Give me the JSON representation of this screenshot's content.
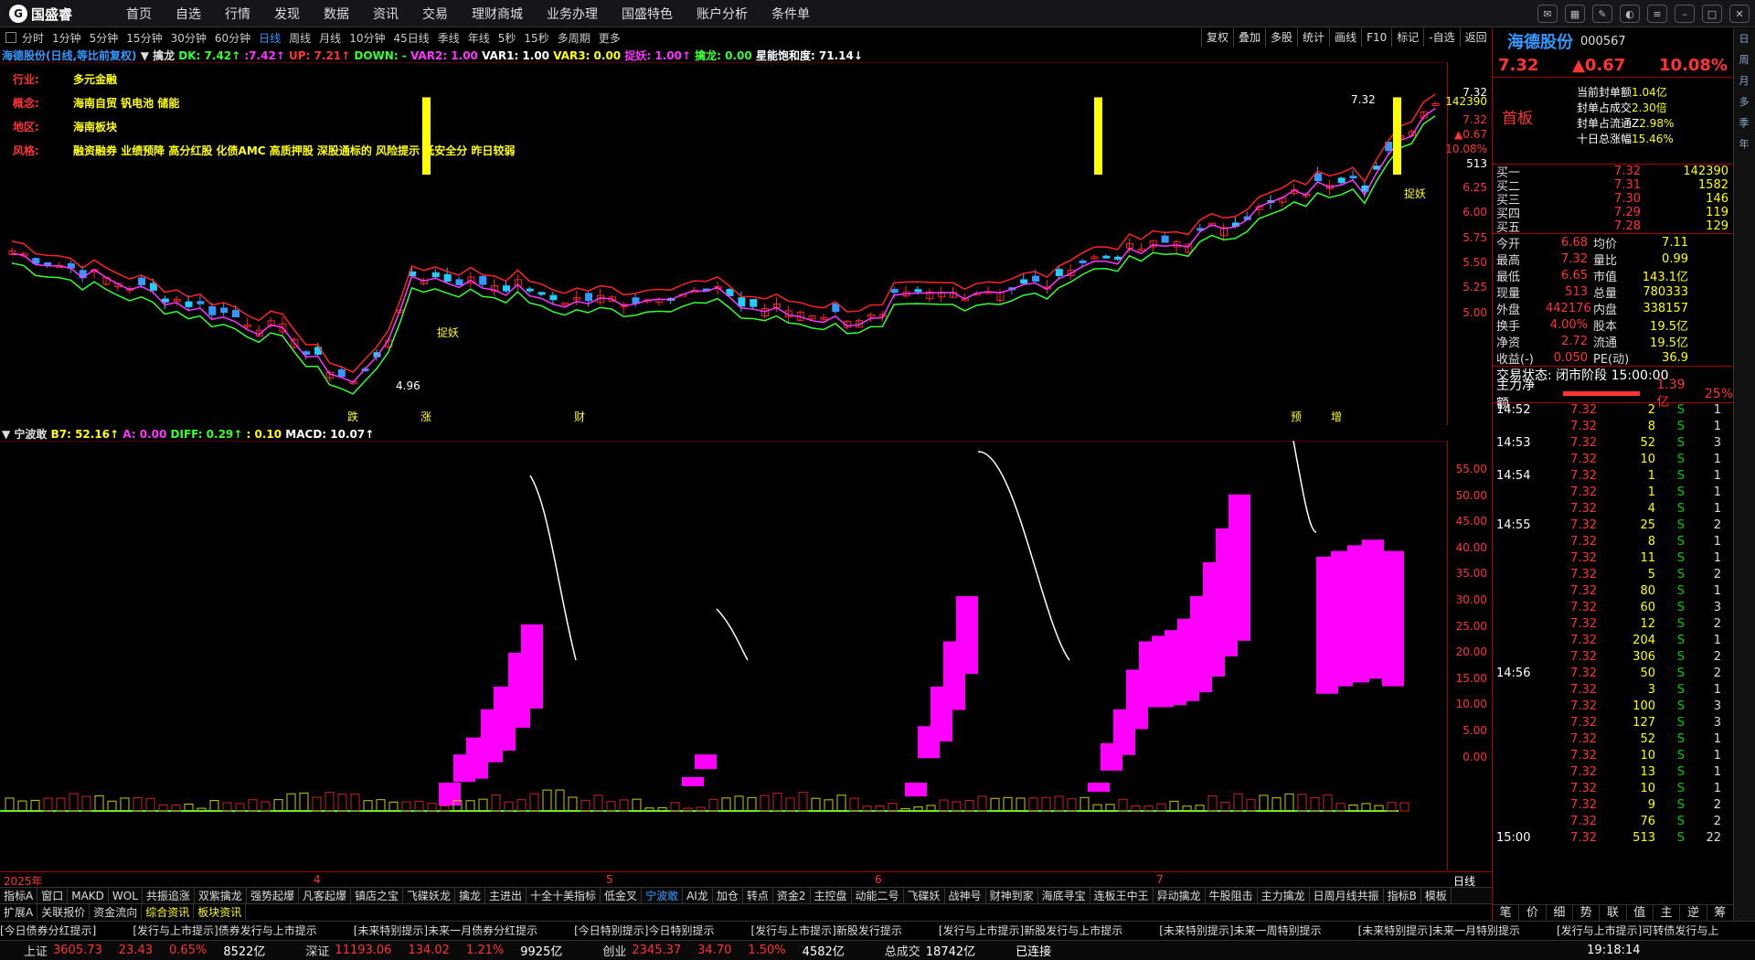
{
  "topbar": {
    "logo": "国盛睿",
    "menu": [
      "首页",
      "自选",
      "行情",
      "发现",
      "数据",
      "资讯",
      "交易",
      "理财商城",
      "业务办理",
      "国盛特色",
      "账户分析",
      "条件单"
    ]
  },
  "periods": [
    "分时",
    "1分钟",
    "5分钟",
    "15分钟",
    "30分钟",
    "60分钟",
    "日线",
    "周线",
    "月线",
    "10分钟",
    "45日线",
    "季线",
    "年线",
    "5秒",
    "15秒",
    "多周期",
    "更多"
  ],
  "active_period": "日线",
  "toolbtns": [
    "复权",
    "叠加",
    "多股",
    "统计",
    "画线",
    "F10",
    "标记",
    "-自选",
    "返回"
  ],
  "ind1": [
    {
      "t": "海德股份(日线,等比前复权)",
      "c": "#39f"
    },
    {
      "t": " ▼ 擒龙 ",
      "c": "#ddd"
    },
    {
      "t": "DK: 7.42↑",
      "c": "#3f3"
    },
    {
      "t": " :7.42↑ ",
      "c": "#f3f"
    },
    {
      "t": " UP: 7.21↑ ",
      "c": "#f33"
    },
    {
      "t": " DOWN: - ",
      "c": "#3f3"
    },
    {
      "t": " VAR2: 1.00 ",
      "c": "#f3f"
    },
    {
      "t": " VAR1: 1.00 ",
      "c": "#fff"
    },
    {
      "t": " VAR3: 0.00 ",
      "c": "#ff0"
    },
    {
      "t": " 捉妖: 1.00↑ ",
      "c": "#f3f"
    },
    {
      "t": " 擒龙: 0.00 ",
      "c": "#3f3"
    },
    {
      "t": " 星能饱和度: 71.14↓",
      "c": "#fff"
    }
  ],
  "info": [
    {
      "k": "行业:",
      "v": "多元金融"
    },
    {
      "k": "概念:",
      "v": "海南自贸 钒电池 储能"
    },
    {
      "k": "地区:",
      "v": "海南板块"
    },
    {
      "k": "风格:",
      "v": "融资融券 业绩预降 高分红股 化债AMC 高质押股 深股通标的 风险提示 低安全分 昨日较弱"
    }
  ],
  "axis1": [
    "7.32",
    "142390",
    "7.32",
    "▲0.67",
    "10.08%",
    "513",
    "6.25",
    "6.00",
    "5.75",
    "5.50",
    "5.25",
    "5.00"
  ],
  "chart1_labels": {
    "high": "7.32",
    "low": "4.96",
    "zhuoyao": "捉妖",
    "events": [
      "跌",
      "涨",
      "财",
      "预",
      "增"
    ]
  },
  "ind2": [
    {
      "t": "▼ 宁波敢 ",
      "c": "#ddd"
    },
    {
      "t": "B7: 52.16↑",
      "c": "#ff0"
    },
    {
      "t": "  A: 0.00 ",
      "c": "#f3f"
    },
    {
      "t": " DIFF: 0.29↑ ",
      "c": "#3f3"
    },
    {
      "t": " : 0.10 ",
      "c": "#ff0"
    },
    {
      "t": " MACD: 10.07↑",
      "c": "#fff"
    }
  ],
  "axis2": [
    "55.00",
    "50.00",
    "45.00",
    "40.00",
    "35.00",
    "30.00",
    "25.00",
    "20.00",
    "15.00",
    "10.00",
    "5.00",
    "0.00"
  ],
  "dateaxis": {
    "year": "2025年",
    "months": [
      "4",
      "5",
      "6",
      "7"
    ],
    "period": "日线"
  },
  "tabs1": [
    "指标A",
    "窗口",
    "MAKD",
    "WOL",
    "共振追涨",
    "双紫擒龙",
    "强势起爆",
    "凡客起爆",
    "镇店之宝",
    "飞碟妖龙",
    "擒龙",
    "主进出",
    "十全十美指标",
    "低金叉",
    "宁波敢",
    "AI龙",
    "加仓",
    "转点",
    "资金2",
    "主控盘",
    "动能二号",
    "飞碟妖",
    "战神号",
    "财神到家",
    "海底寻宝",
    "连板王中王",
    "异动擒龙",
    "牛股阻击",
    "主力擒龙",
    "日周月线共振",
    "指标B",
    "模板"
  ],
  "tabs2": [
    "扩展A",
    "关联报价",
    "资金流向",
    "综合资讯",
    "板块资讯"
  ],
  "ticker": [
    "[今日债券分红提示]",
    "[发行与上市提示]债券发行与上市提示",
    "[未来特别提示]未来一月债券分红提示",
    "[今日特别提示]今日特别提示",
    "[发行与上市提示]新股发行提示",
    "[发行与上市提示]新股发行与上市提示",
    "[未来特别提示]未来一周特别提示",
    "[未来特别提示]未来一月特别提示",
    "[发行与上市提示]可转债发行与上"
  ],
  "status": {
    "items": [
      {
        "l": "上证",
        "v": "3605.73",
        "c": "23.43",
        "p": "0.65%",
        "a": "8522亿"
      },
      {
        "l": "深证",
        "v": "11193.06",
        "c": "134.02",
        "p": "1.21%",
        "a": "9925亿"
      },
      {
        "l": "创业",
        "v": "2345.37",
        "c": "34.70",
        "p": "1.50%",
        "a": "4582亿"
      }
    ],
    "total_label": "总成交",
    "total": "18742亿",
    "conn": "已连接",
    "time": "19:18:14"
  },
  "stock": {
    "name": "海德股份",
    "code": "000567",
    "price": "7.32",
    "change": "▲0.67",
    "pct": "10.08%"
  },
  "seal": {
    "tag": "首板",
    "rows": [
      {
        "k": "当前封单额",
        "v": "1.04亿"
      },
      {
        "k": "封单占成交",
        "v": "2.30倍"
      },
      {
        "k": "封单占流通Z",
        "v": "2.98%"
      },
      {
        "k": "十日总涨幅",
        "v": "15.46%"
      }
    ]
  },
  "bids": [
    {
      "k": "买一",
      "p": "7.32",
      "v": "142390"
    },
    {
      "k": "买二",
      "p": "7.31",
      "v": "1582"
    },
    {
      "k": "买三",
      "p": "7.30",
      "v": "146"
    },
    {
      "k": "买四",
      "p": "7.29",
      "v": "119"
    },
    {
      "k": "买五",
      "p": "7.28",
      "v": "129"
    }
  ],
  "stats": [
    [
      "今开",
      "6.68",
      "均价",
      "7.11"
    ],
    [
      "最高",
      "7.32",
      "量比",
      "0.99"
    ],
    [
      "最低",
      "6.65",
      "市值",
      "143.1亿"
    ],
    [
      "现量",
      "513",
      "总量",
      "780333"
    ],
    [
      "外盘",
      "442176",
      "内盘",
      "338157"
    ],
    [
      "换手",
      "4.00%",
      "股本",
      "19.5亿"
    ],
    [
      "净资",
      "2.72",
      "流通",
      "19.5亿"
    ],
    [
      "收益(-)",
      "0.050",
      "PE(动)",
      "36.9"
    ]
  ],
  "tradestate": "交易状态: 闭市阶段 15:00:00",
  "netflow": {
    "label": "主力净额",
    "value": "1.39亿",
    "pct": "25%"
  },
  "ticks": [
    [
      "14:52",
      "7.32",
      "2",
      "S",
      "1"
    ],
    [
      "",
      "7.32",
      "8",
      "S",
      "1"
    ],
    [
      "14:53",
      "7.32",
      "52",
      "S",
      "3"
    ],
    [
      "",
      "7.32",
      "10",
      "S",
      "1"
    ],
    [
      "14:54",
      "7.32",
      "1",
      "S",
      "1"
    ],
    [
      "",
      "7.32",
      "1",
      "S",
      "1"
    ],
    [
      "",
      "7.32",
      "4",
      "S",
      "1"
    ],
    [
      "14:55",
      "7.32",
      "25",
      "S",
      "2"
    ],
    [
      "",
      "7.32",
      "8",
      "S",
      "1"
    ],
    [
      "",
      "7.32",
      "11",
      "S",
      "1"
    ],
    [
      "",
      "7.32",
      "5",
      "S",
      "2"
    ],
    [
      "",
      "7.32",
      "80",
      "S",
      "1"
    ],
    [
      "",
      "7.32",
      "60",
      "S",
      "3"
    ],
    [
      "",
      "7.32",
      "12",
      "S",
      "2"
    ],
    [
      "",
      "7.32",
      "204",
      "S",
      "1"
    ],
    [
      "",
      "7.32",
      "306",
      "S",
      "2"
    ],
    [
      "14:56",
      "7.32",
      "50",
      "S",
      "2"
    ],
    [
      "",
      "7.32",
      "3",
      "S",
      "1"
    ],
    [
      "",
      "7.32",
      "100",
      "S",
      "3"
    ],
    [
      "",
      "7.32",
      "127",
      "S",
      "3"
    ],
    [
      "",
      "7.32",
      "52",
      "S",
      "1"
    ],
    [
      "",
      "7.32",
      "10",
      "S",
      "1"
    ],
    [
      "",
      "7.32",
      "13",
      "S",
      "1"
    ],
    [
      "",
      "7.32",
      "10",
      "S",
      "1"
    ],
    [
      "",
      "7.32",
      "9",
      "S",
      "2"
    ],
    [
      "",
      "7.32",
      "76",
      "S",
      "2"
    ],
    [
      "15:00",
      "7.32",
      "513",
      "S",
      "22"
    ]
  ],
  "rpbottom": [
    "笔",
    "价",
    "细",
    "势",
    "联",
    "值",
    "主",
    "逆",
    "筹"
  ],
  "sidebar": [
    "日",
    "周",
    "月",
    "多",
    "季",
    "年"
  ]
}
